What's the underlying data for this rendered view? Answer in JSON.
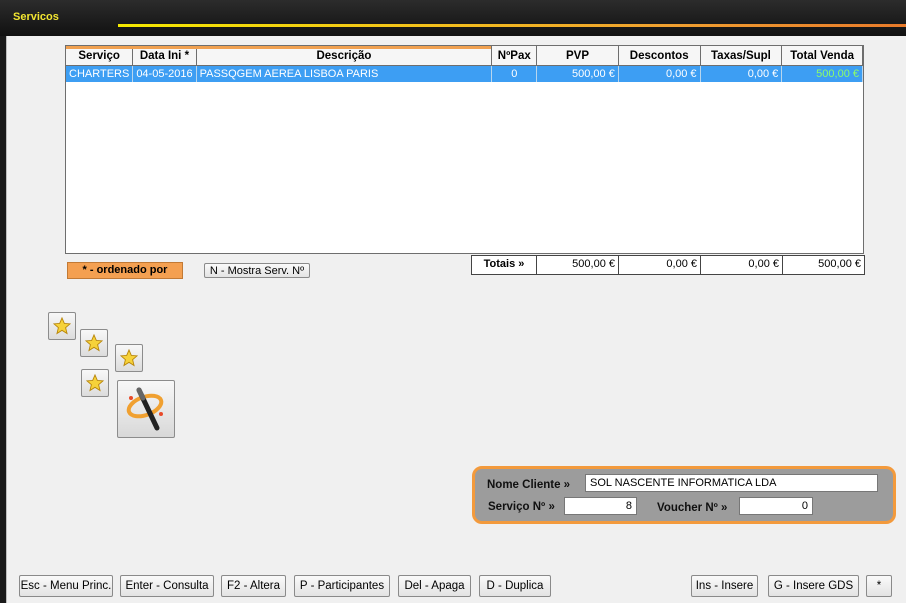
{
  "window": {
    "title": "Servicos"
  },
  "table": {
    "headers": [
      "Serviço",
      "Data Ini *",
      "Descrição",
      "NºPax",
      "PVP",
      "Descontos",
      "Taxas/Supl",
      "Total Venda"
    ],
    "rows": [
      [
        "CHARTERS",
        "04-05-2016",
        "PASSQGEM AEREA LISBOA PARIS",
        "0",
        "500,00 €",
        "0,00 €",
        "0,00 €",
        "500,00 €"
      ]
    ]
  },
  "totals": {
    "label": "Totais »",
    "pvp": "500,00 €",
    "descontos": "0,00 €",
    "taxas": "0,00 €",
    "total": "500,00 €"
  },
  "ordered_label": "* - ordenado por",
  "show_serv_button": "N - Mostra Serv. Nº",
  "icons": [
    "star-icon",
    "star-icon",
    "star-icon",
    "star-icon",
    "magic-wand-icon"
  ],
  "client": {
    "name_label": "Nome Cliente »",
    "name_value": "SOL NASCENTE INFORMATICA LDA",
    "servico_label": "Serviço Nº »",
    "servico_value": "8",
    "voucher_label": "Voucher Nº »",
    "voucher_value": "0"
  },
  "footer": {
    "esc": "Esc - Menu Princ.",
    "enter": "Enter - Consulta",
    "f2": "F2 - Altera",
    "p": "P - Participantes",
    "del": "Del - Apaga",
    "d": "D - Duplica",
    "ins": "Ins - Insere",
    "g": "G - Insere GDS",
    "star": "*"
  },
  "colors": {
    "accent_orange": "#f39a3c",
    "selected_row": "#3d9ef3",
    "title_yellow": "#f2e531"
  }
}
